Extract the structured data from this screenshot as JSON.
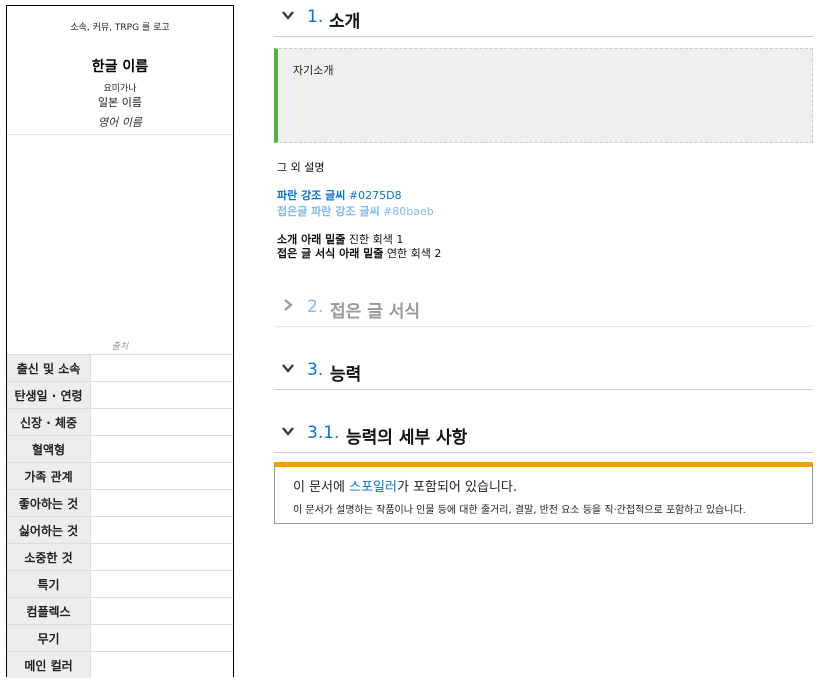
{
  "infobox": {
    "tagline": "소속, 커뮤, TRPG 를 로고",
    "korean_name": "한글 이름",
    "yomigana": "요미가나",
    "japanese_name": "일본 이름",
    "english_name": "영어 이름",
    "source": "출처",
    "rows": [
      {
        "label": "출신 및 소속",
        "value": ""
      },
      {
        "label": "탄생일 · 연령",
        "value": ""
      },
      {
        "label": "신장 · 체중",
        "value": ""
      },
      {
        "label": "혈액형",
        "value": ""
      },
      {
        "label": "가족 관계",
        "value": ""
      },
      {
        "label": "좋아하는 것",
        "value": ""
      },
      {
        "label": "싫어하는 것",
        "value": ""
      },
      {
        "label": "소중한 것",
        "value": ""
      },
      {
        "label": "특기",
        "value": ""
      },
      {
        "label": "컴플렉스",
        "value": ""
      },
      {
        "label": "무기",
        "value": ""
      },
      {
        "label": "메인 컬러",
        "value": ""
      }
    ]
  },
  "sections": {
    "s1": {
      "num": "1.",
      "title": "소개"
    },
    "s2": {
      "num": "2.",
      "title": "접은 글 서식"
    },
    "s3": {
      "num": "3.",
      "title": "능력"
    },
    "s31": {
      "num": "3.1.",
      "title": "능력의 세부 사항"
    }
  },
  "intro": {
    "box_text": "자기소개",
    "other_desc": "그 외 설명",
    "blue_label": "파란 강조 글씨",
    "blue_value": "#0275D8",
    "folded_blue_label": "접은글 파란 강조 글씨",
    "folded_blue_value": "#80baeb",
    "line1_bold": "소개 아래 밑줄",
    "line1_rest": "진한 회색 1",
    "line2_bold": "접은 글 서식 아래 밑줄",
    "line2_rest": "연한 회색 2"
  },
  "spoiler": {
    "before": "이 문서에 ",
    "highlight": "스포일러",
    "after": "가 포함되어 있습니다.",
    "desc": "이 문서가 설명하는 작품이나 인물 등에 대한 줄거리, 결말, 반전 요소 등을 직·간접적으로 포함하고 있습니다."
  },
  "colors": {
    "accent_blue": "#0275D8",
    "folded_blue": "#80baeb",
    "intro_bar": "#5aac44",
    "spoiler_bar": "#f0a000"
  },
  "icons": {
    "expanded": "chevron-down-icon",
    "collapsed": "chevron-right-icon"
  }
}
